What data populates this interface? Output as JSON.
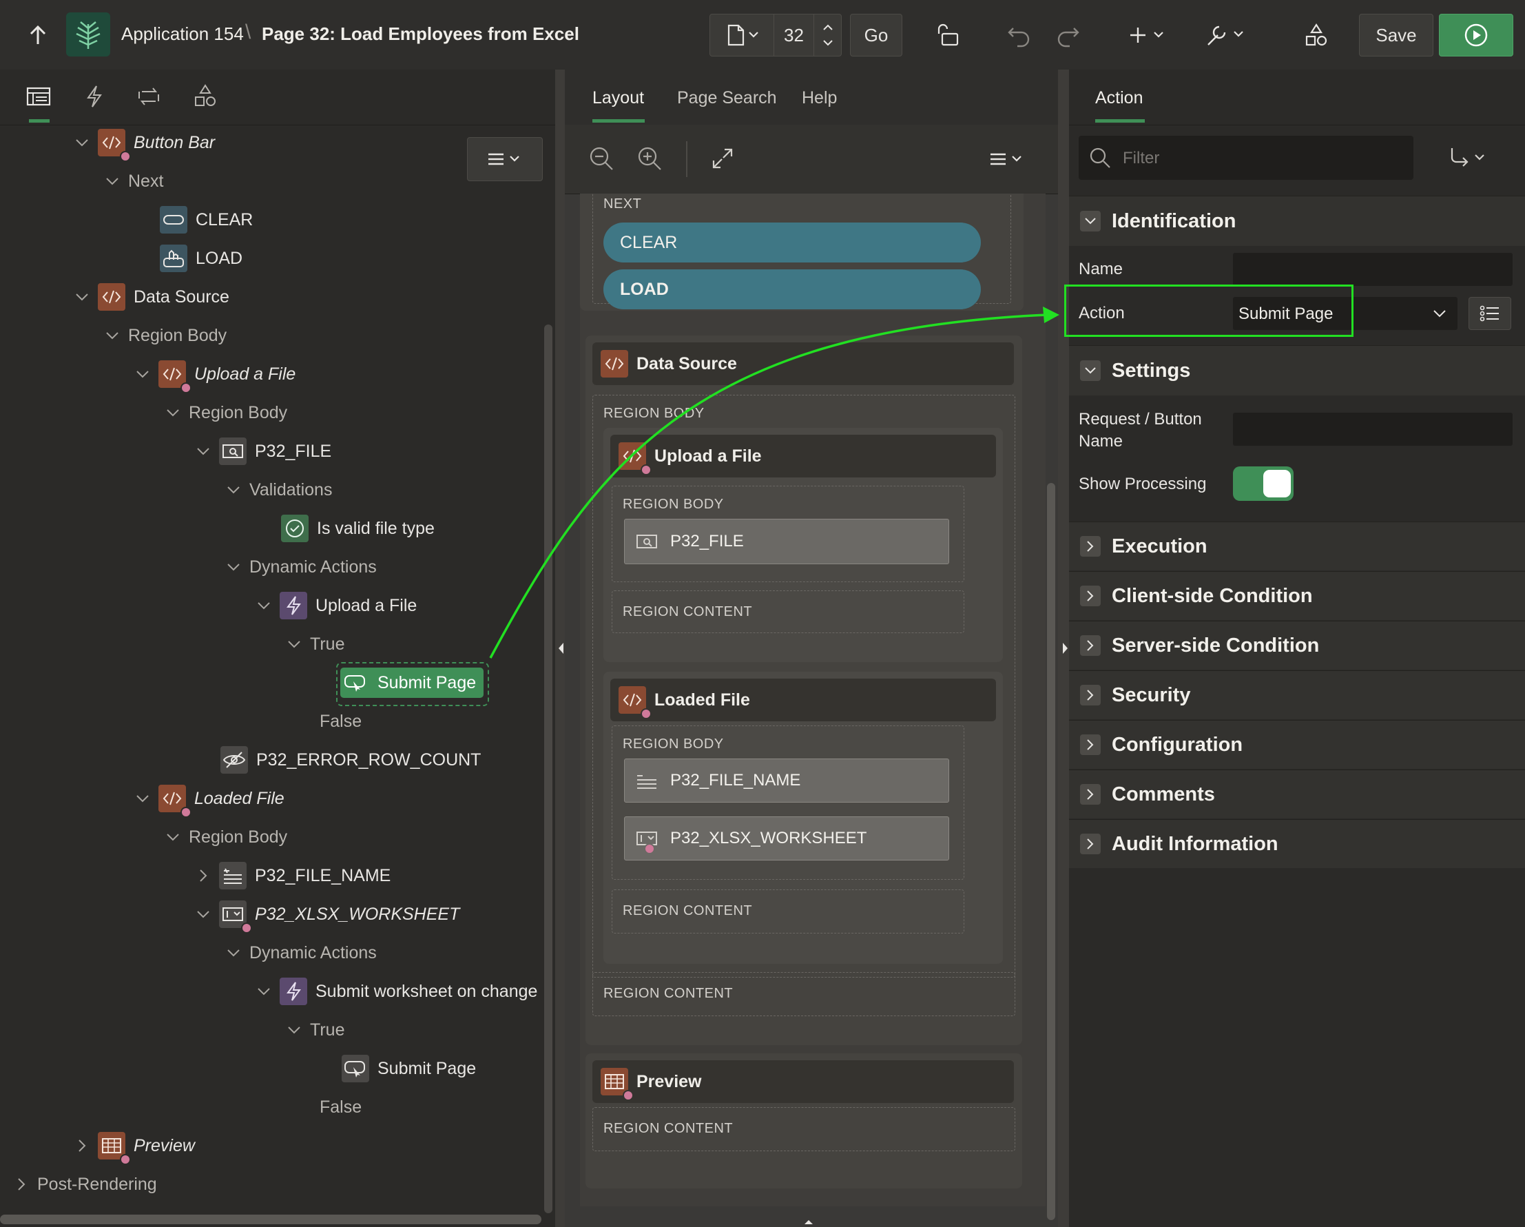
{
  "header": {
    "app_name": "Application 154",
    "separator": "\\",
    "page_title": "Page 32: Load Employees from Excel",
    "page_number": "32",
    "go_label": "Go",
    "save_label": "Save"
  },
  "left": {
    "tree": [
      {
        "label": "Button Bar",
        "italic": true
      },
      {
        "label": "Next"
      },
      {
        "label": "CLEAR"
      },
      {
        "label": "LOAD"
      },
      {
        "label": "Data Source"
      },
      {
        "label": "Region Body"
      },
      {
        "label": "Upload a File",
        "italic": true
      },
      {
        "label": "Region Body"
      },
      {
        "label": "P32_FILE"
      },
      {
        "label": "Validations"
      },
      {
        "label": "Is valid file type"
      },
      {
        "label": "Dynamic Actions"
      },
      {
        "label": "Upload a File"
      },
      {
        "label": "True"
      },
      {
        "label": "Submit Page",
        "selected": true
      },
      {
        "label": "False"
      },
      {
        "label": "P32_ERROR_ROW_COUNT"
      },
      {
        "label": "Loaded File",
        "italic": true
      },
      {
        "label": "Region Body"
      },
      {
        "label": "P32_FILE_NAME"
      },
      {
        "label": "P32_XLSX_WORKSHEET",
        "italic": true
      },
      {
        "label": "Dynamic Actions"
      },
      {
        "label": "Submit worksheet on change"
      },
      {
        "label": "True"
      },
      {
        "label": "Submit Page"
      },
      {
        "label": "False"
      },
      {
        "label": "Preview",
        "italic": true
      },
      {
        "label": "Post-Rendering"
      }
    ]
  },
  "middle": {
    "tabs": [
      "Layout",
      "Page Search",
      "Help"
    ],
    "next_label": "NEXT",
    "clear_btn": "CLEAR",
    "load_btn": "LOAD",
    "data_source": "Data Source",
    "region_body": "REGION BODY",
    "region_content": "REGION CONTENT",
    "upload_file": "Upload a File",
    "p32_file": "P32_FILE",
    "loaded_file": "Loaded File",
    "p32_file_name": "P32_FILE_NAME",
    "p32_xlsx_worksheet": "P32_XLSX_WORKSHEET",
    "preview": "Preview"
  },
  "right": {
    "tab": "Action",
    "filter_placeholder": "Filter",
    "identification": "Identification",
    "name_label": "Name",
    "action_label": "Action",
    "action_value": "Submit Page",
    "settings": "Settings",
    "request_label": "Request / Button Name",
    "show_processing_label": "Show Processing",
    "show_processing_on": true,
    "sections": [
      "Execution",
      "Client-side Condition",
      "Server-side Condition",
      "Security",
      "Configuration",
      "Comments",
      "Audit Information"
    ]
  },
  "colors": {
    "highlight": "#22e022",
    "accent_green": "#3f8f57",
    "region_icon": "#8a4a32",
    "button_teal": "#3f7785"
  }
}
